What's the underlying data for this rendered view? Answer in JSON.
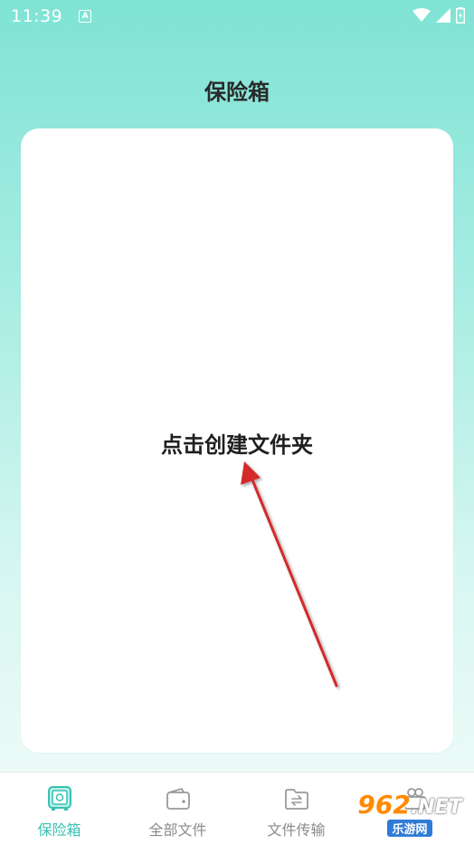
{
  "status_bar": {
    "time": "11:39",
    "notification_letter": "A"
  },
  "header": {
    "title": "保险箱"
  },
  "main": {
    "create_folder_text": "点击创建文件夹"
  },
  "bottom_nav": {
    "items": [
      {
        "label": "保险箱",
        "icon": "safe-icon",
        "active": true
      },
      {
        "label": "全部文件",
        "icon": "wallet-icon",
        "active": false
      },
      {
        "label": "文件传输",
        "icon": "folder-transfer-icon",
        "active": false
      },
      {
        "label": "",
        "icon": "gift-icon",
        "active": false
      }
    ]
  },
  "watermark": {
    "logo": "962",
    "net": ".NET",
    "sub": "乐游网"
  },
  "colors": {
    "accent": "#36c2b4",
    "inactive": "#8a8a8a",
    "arrow": "#d42b2b"
  }
}
